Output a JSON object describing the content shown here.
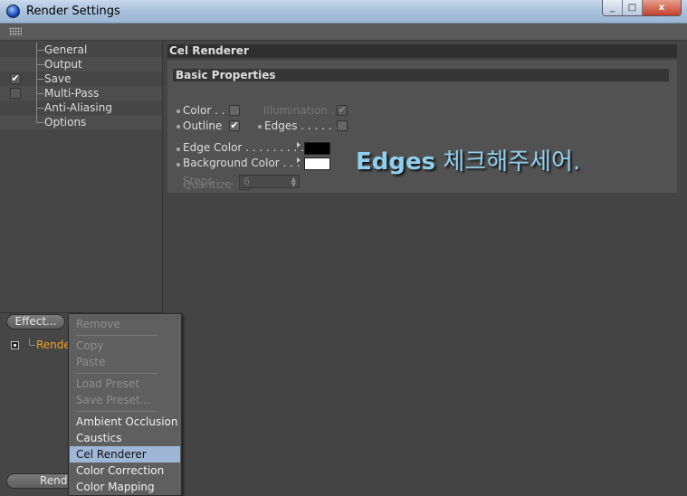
{
  "window": {
    "title": "Render Settings",
    "controls": [
      "_",
      "□",
      "x"
    ]
  },
  "left_tree": {
    "items": [
      {
        "label": "General",
        "checked": null
      },
      {
        "label": "Output",
        "checked": null
      },
      {
        "label": "Save",
        "checked": true,
        "check_glyph": "✔"
      },
      {
        "label": "Multi-Pass",
        "checked": false,
        "check_glyph": ""
      },
      {
        "label": "Anti-Aliasing",
        "checked": null
      },
      {
        "label": "Options",
        "checked": null
      }
    ]
  },
  "effects": {
    "effect_button_label": "Effect...",
    "render_button_label": "Rend",
    "list": [
      {
        "label": "Rende",
        "color": "#f2a21e"
      }
    ]
  },
  "panel": {
    "title": "Cel Renderer",
    "group_title": "Basic Properties",
    "color_label": "Color . .",
    "illumination_label": "Illumination . .",
    "illumination_glyph": "✔",
    "outline_label": "Outline",
    "outline_glyph": "✔",
    "edges_label": "Edges . . . . . . .",
    "edges_glyph": "",
    "edge_color_label": "Edge Color . . . . . . . . .",
    "edge_color": "#000000",
    "background_color_label": "Background Color . . .",
    "background_color": "#ffffff",
    "quantize_label": "Quantize",
    "steps_label": "Steps . . . .",
    "steps_value": "6",
    "spin_up": "▲",
    "spin_down": "▼"
  },
  "annotation": {
    "english": "Edges",
    "korean": " 체크해주세어."
  },
  "context_menu": {
    "items": [
      {
        "label": "Remove",
        "enabled": false
      },
      {
        "sep": true
      },
      {
        "label": "Copy",
        "enabled": false
      },
      {
        "label": "Paste",
        "enabled": false
      },
      {
        "sep": true
      },
      {
        "label": "Load Preset",
        "enabled": false
      },
      {
        "label": "Save Preset...",
        "enabled": false
      },
      {
        "sep": true
      },
      {
        "label": "Ambient Occlusion",
        "enabled": true
      },
      {
        "label": "Caustics",
        "enabled": true
      },
      {
        "label": "Cel Renderer",
        "enabled": true,
        "selected": true
      },
      {
        "label": "Color Correction",
        "enabled": true
      },
      {
        "label": "Color Mapping",
        "enabled": true
      }
    ]
  },
  "colors": {
    "accent_selection": "#9fb6d6",
    "annotation_text": "#8fd0ee"
  }
}
